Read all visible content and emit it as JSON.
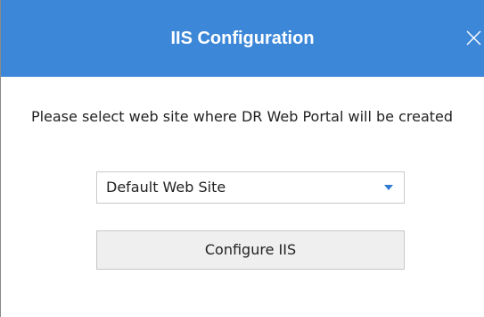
{
  "dialog": {
    "title": "IIS Configuration",
    "close_icon": "close-icon"
  },
  "prompt": {
    "text": "Please select web site where DR Web Portal will be created"
  },
  "site_select": {
    "value": "Default Web Site",
    "arrow_icon": "dropdown-arrow-icon"
  },
  "actions": {
    "configure_label": "Configure IIS"
  },
  "colors": {
    "titlebar": "#3c87d8",
    "title_text": "#ffffff",
    "arrow": "#2f7bd1",
    "button_bg": "#efefef"
  }
}
